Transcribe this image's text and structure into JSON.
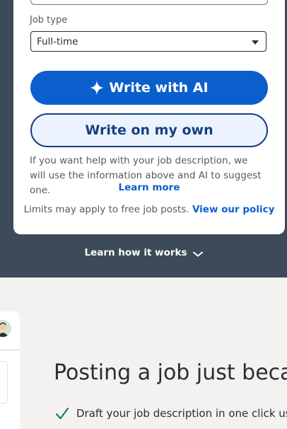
{
  "form": {
    "job_type_label": "Job type",
    "job_type_value": "Full-time",
    "write_ai_label": "Write with AI",
    "write_own_label": "Write on my own",
    "help_text": "If you want help with your job description, we will use the information above and AI to suggest one.",
    "learn_more_label": "Learn more",
    "limits_text": "Limits may apply to free job posts.",
    "policy_link_label": "View our policy"
  },
  "learn_how": {
    "label": "Learn how it works"
  },
  "promo": {
    "headline": "Posting a job just becar",
    "bullet_1": "Draft your job description in one click usir"
  },
  "colors": {
    "primary_blue": "#0b5fcc",
    "dark_navy": "#164081",
    "slate_band": "#3c4a5a",
    "check_green": "#1e7a4e"
  },
  "icons": {
    "sparkle": "sparkle-icon",
    "chevron": "chevron-down-icon",
    "check": "check-icon",
    "caret": "caret-down-icon"
  }
}
